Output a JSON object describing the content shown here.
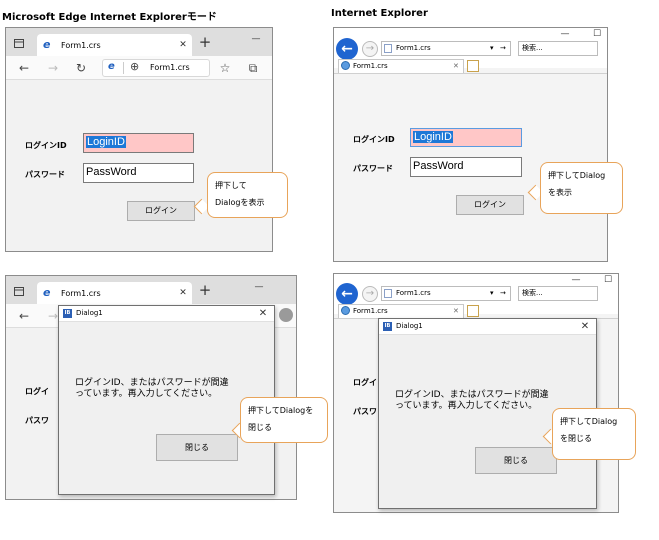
{
  "headings": {
    "edge": "Microsoft Edge Internet Explorerモード",
    "ie": "Internet Explorer"
  },
  "edge": {
    "tab_title": "Form1.crs",
    "address": "Form1.crs",
    "icons": {
      "tabs": "tab-actions-icon",
      "tab_favicon": "ie-e-icon",
      "close": "close-icon",
      "new_tab": "plus-icon",
      "minimize": "minimize-icon",
      "back": "back-arrow-icon",
      "forward": "forward-arrow-icon",
      "refresh": "refresh-icon",
      "ie_mode": "ie-mode-icon",
      "globe": "globe-icon",
      "favorite": "star-add-icon",
      "collections": "collections-icon",
      "profile": "profile-icon"
    },
    "glyphs": {
      "close": "✕",
      "new_tab": "+",
      "minimize": "—",
      "back": "←",
      "forward": "→",
      "refresh": "↻",
      "globe": "⊕",
      "favorite": "☆",
      "collections": "⧉",
      "e": "e"
    }
  },
  "ie": {
    "tab_title": "Form1.crs",
    "address": "Form1.crs",
    "search": "検索...",
    "glyphs": {
      "back": "←",
      "forward": "→",
      "dropdown": "▾",
      "go": "→",
      "tab_close": "✕",
      "minimize": "—",
      "maximize": "☐"
    }
  },
  "form": {
    "login_label": "ログインID",
    "password_label": "パスワード",
    "login_value": "LoginID",
    "password_value": "PassWord",
    "login_button": "ログイン",
    "login_highlight_color": "#ffc7c7"
  },
  "dialog": {
    "title": "Dialog1",
    "icon_text": "IB",
    "message_line1": "ログインID、またはパスワードが間違",
    "message_line2": "っています。再入力してください。",
    "close_button": "閉じる",
    "close_glyph": "✕",
    "edge_covered_label_1": "ログイ",
    "edge_covered_label_2": "パスワ",
    "ie_covered_label_1": "ログイ",
    "ie_covered_label_2": "パスワ"
  },
  "callouts": {
    "login_line1": "押下して",
    "login_line2": "Dialogを表示",
    "ie_login_line1": "押下してDialog",
    "ie_login_line2": "を表示",
    "close_line1": "押下してDialogを",
    "close_line2": "閉じる",
    "ie_close_line1": "押下してDialog",
    "ie_close_line2": "を閉じる",
    "border_color": "#e8a45a"
  }
}
